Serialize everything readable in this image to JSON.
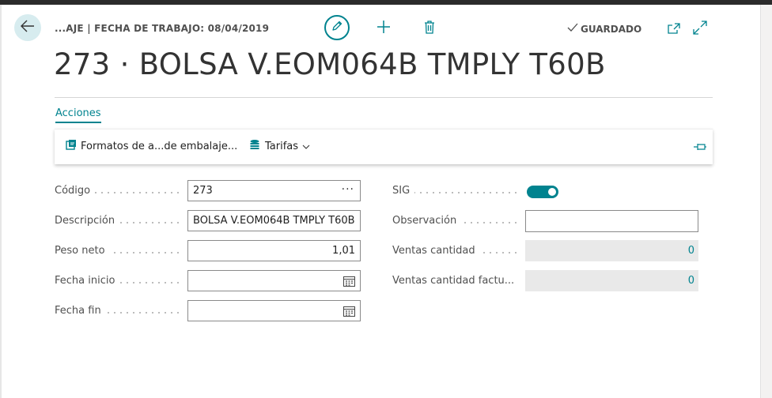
{
  "header": {
    "breadcrumb": "...AJE | FECHA DE TRABAJO: 08/04/2019",
    "saved_status": "GUARDADO",
    "title": "273 · BOLSA V.EOM064B TMPLY T60B"
  },
  "tabs": {
    "actions_label": "Acciones"
  },
  "action_bar": {
    "formatos_label": "Formatos de a...de embalaje...",
    "tarifas_label": "Tarifas"
  },
  "left_fields": {
    "codigo": {
      "label": "Código",
      "value": "273"
    },
    "descripcion": {
      "label": "Descripción",
      "value": "BOLSA V.EOM064B TMPLY T60B"
    },
    "peso_neto": {
      "label": "Peso neto",
      "value": "1,01"
    },
    "fecha_inicio": {
      "label": "Fecha inicio",
      "value": ""
    },
    "fecha_fin": {
      "label": "Fecha fin",
      "value": ""
    }
  },
  "right_fields": {
    "sig": {
      "label": "SIG",
      "value": true
    },
    "observacion": {
      "label": "Observación",
      "value": ""
    },
    "ventas_cantidad": {
      "label": "Ventas cantidad",
      "value": "0"
    },
    "ventas_cantidad_factu": {
      "label": "Ventas cantidad factu...",
      "value": "0"
    }
  },
  "colors": {
    "accent": "#00838f",
    "back_button_bg": "#d7ecef",
    "readonly_bg": "#e9e9e9"
  },
  "icons": [
    "back-arrow-icon",
    "pencil-icon",
    "plus-icon",
    "trash-icon",
    "checkmark-icon",
    "open-new-window-icon",
    "expand-icon",
    "packaging-formats-icon",
    "coins-icon",
    "chevron-down-icon",
    "pin-icon",
    "calendar-icon",
    "ellipsis-icon"
  ]
}
